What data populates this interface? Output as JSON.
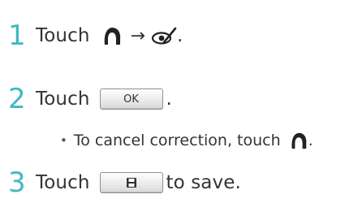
{
  "steps": [
    {
      "number": "1",
      "text": "Touch",
      "arrow": "→",
      "end": "."
    },
    {
      "number": "2",
      "text": "Touch",
      "button_label": "OK",
      "end": "."
    },
    {
      "number": "3",
      "text": "Touch",
      "end": " to save."
    }
  ],
  "note": {
    "bullet": "•",
    "text": "To cancel correction, touch",
    "end": "."
  },
  "icons": {
    "step1_first": "head-outline-icon",
    "step1_second": "red-eye-correction-icon",
    "note_icon": "head-outline-icon",
    "step3_button": "save-icon"
  }
}
